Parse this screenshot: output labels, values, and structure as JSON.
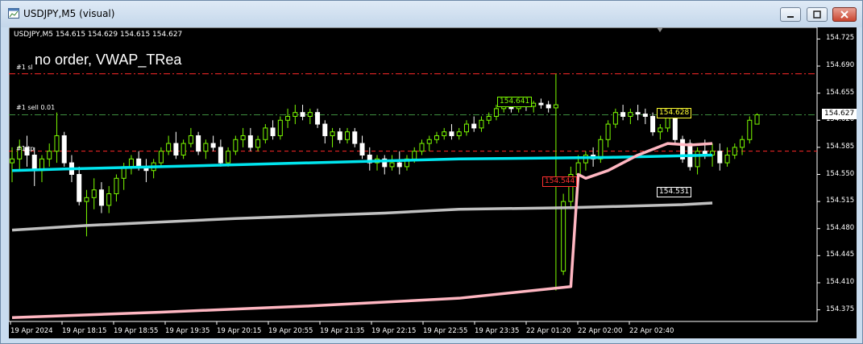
{
  "window": {
    "title": "USDJPY,M5 (visual)",
    "icon": "chart-window-icon",
    "buttons": [
      "minimize-icon",
      "maximize-icon",
      "close-icon"
    ]
  },
  "chart": {
    "info_line": "USDJPY,M5  154.615 154.629 154.615 154.627",
    "comment": "no order, VWAP_TRea",
    "level_labels": {
      "sl": "#1 sl",
      "sell": "#1 sell 0.01",
      "tp": "#1 tp"
    },
    "price_labels": {
      "green": "154.641",
      "red": "154.544",
      "bid": "154.627",
      "yellow": "154.628",
      "white": "154.531"
    },
    "colors": {
      "background": "#000000",
      "bull": "#7cfc00",
      "bear": "#ffffff",
      "vwap_fast": "#00e5ee",
      "vwap_slow": "#c0c0c0",
      "vwap_pink": "#ffb6c1",
      "sl_line": "#ff2a2a",
      "sell_line": "#3f8f3f"
    }
  },
  "chart_data": {
    "type": "line",
    "symbol": "USDJPY",
    "timeframe": "M5",
    "ylim": [
      154.36,
      154.74
    ],
    "y_ticks": [
      "154.725",
      "154.690",
      "154.655",
      "154.620",
      "154.585",
      "154.550",
      "154.515",
      "154.480",
      "154.445",
      "154.410",
      "154.375"
    ],
    "x_ticks": [
      "19 Apr 2024",
      "19 Apr 18:15",
      "19 Apr 18:55",
      "19 Apr 19:35",
      "19 Apr 20:15",
      "19 Apr 20:55",
      "19 Apr 21:35",
      "19 Apr 22:15",
      "19 Apr 22:55",
      "19 Apr 23:35",
      "22 Apr 01:20",
      "22 Apr 02:00",
      "22 Apr 02:40"
    ],
    "levels": [
      {
        "name": "#1 sl",
        "value": 154.68,
        "style": "dash-dot",
        "color": "#ff2a2a"
      },
      {
        "name": "#1 sell 0.01",
        "value": 154.627,
        "style": "dash-dot",
        "color": "#3f8f3f"
      },
      {
        "name": "#1 tp",
        "value": 154.58,
        "style": "dash",
        "color": "#ff2a2a"
      }
    ],
    "candles": [
      {
        "o": 154.565,
        "h": 154.585,
        "l": 154.54,
        "c": 154.57
      },
      {
        "o": 154.57,
        "h": 154.595,
        "l": 154.555,
        "c": 154.585
      },
      {
        "o": 154.585,
        "h": 154.6,
        "l": 154.56,
        "c": 154.575
      },
      {
        "o": 154.575,
        "h": 154.585,
        "l": 154.535,
        "c": 154.555
      },
      {
        "o": 154.555,
        "h": 154.575,
        "l": 154.54,
        "c": 154.57
      },
      {
        "o": 154.57,
        "h": 154.59,
        "l": 154.56,
        "c": 154.58
      },
      {
        "o": 154.58,
        "h": 154.63,
        "l": 154.565,
        "c": 154.6
      },
      {
        "o": 154.6,
        "h": 154.605,
        "l": 154.56,
        "c": 154.565
      },
      {
        "o": 154.565,
        "h": 154.575,
        "l": 154.54,
        "c": 154.55
      },
      {
        "o": 154.55,
        "h": 154.56,
        "l": 154.51,
        "c": 154.515
      },
      {
        "o": 154.515,
        "h": 154.53,
        "l": 154.47,
        "c": 154.52
      },
      {
        "o": 154.52,
        "h": 154.545,
        "l": 154.505,
        "c": 154.53
      },
      {
        "o": 154.53,
        "h": 154.54,
        "l": 154.5,
        "c": 154.51
      },
      {
        "o": 154.51,
        "h": 154.535,
        "l": 154.5,
        "c": 154.525
      },
      {
        "o": 154.525,
        "h": 154.55,
        "l": 154.515,
        "c": 154.545
      },
      {
        "o": 154.545,
        "h": 154.565,
        "l": 154.53,
        "c": 154.56
      },
      {
        "o": 154.56,
        "h": 154.575,
        "l": 154.55,
        "c": 154.57
      },
      {
        "o": 154.57,
        "h": 154.58,
        "l": 154.555,
        "c": 154.56
      },
      {
        "o": 154.56,
        "h": 154.57,
        "l": 154.54,
        "c": 154.555
      },
      {
        "o": 154.555,
        "h": 154.57,
        "l": 154.545,
        "c": 154.565
      },
      {
        "o": 154.565,
        "h": 154.585,
        "l": 154.56,
        "c": 154.58
      },
      {
        "o": 154.58,
        "h": 154.6,
        "l": 154.575,
        "c": 154.59
      },
      {
        "o": 154.59,
        "h": 154.605,
        "l": 154.57,
        "c": 154.575
      },
      {
        "o": 154.575,
        "h": 154.595,
        "l": 154.57,
        "c": 154.59
      },
      {
        "o": 154.59,
        "h": 154.61,
        "l": 154.585,
        "c": 154.6
      },
      {
        "o": 154.6,
        "h": 154.605,
        "l": 154.575,
        "c": 154.58
      },
      {
        "o": 154.58,
        "h": 154.595,
        "l": 154.57,
        "c": 154.59
      },
      {
        "o": 154.59,
        "h": 154.6,
        "l": 154.58,
        "c": 154.585
      },
      {
        "o": 154.585,
        "h": 154.595,
        "l": 154.56,
        "c": 154.565
      },
      {
        "o": 154.565,
        "h": 154.585,
        "l": 154.56,
        "c": 154.58
      },
      {
        "o": 154.58,
        "h": 154.6,
        "l": 154.575,
        "c": 154.595
      },
      {
        "o": 154.595,
        "h": 154.61,
        "l": 154.585,
        "c": 154.6
      },
      {
        "o": 154.6,
        "h": 154.61,
        "l": 154.58,
        "c": 154.585
      },
      {
        "o": 154.585,
        "h": 154.6,
        "l": 154.58,
        "c": 154.595
      },
      {
        "o": 154.595,
        "h": 154.615,
        "l": 154.59,
        "c": 154.61
      },
      {
        "o": 154.61,
        "h": 154.62,
        "l": 154.595,
        "c": 154.6
      },
      {
        "o": 154.6,
        "h": 154.625,
        "l": 154.595,
        "c": 154.62
      },
      {
        "o": 154.62,
        "h": 154.635,
        "l": 154.61,
        "c": 154.625
      },
      {
        "o": 154.625,
        "h": 154.64,
        "l": 154.615,
        "c": 154.63
      },
      {
        "o": 154.63,
        "h": 154.64,
        "l": 154.62,
        "c": 154.625
      },
      {
        "o": 154.625,
        "h": 154.635,
        "l": 154.615,
        "c": 154.63
      },
      {
        "o": 154.63,
        "h": 154.635,
        "l": 154.61,
        "c": 154.615
      },
      {
        "o": 154.615,
        "h": 154.62,
        "l": 154.59,
        "c": 154.6
      },
      {
        "o": 154.6,
        "h": 154.61,
        "l": 154.585,
        "c": 154.605
      },
      {
        "o": 154.605,
        "h": 154.61,
        "l": 154.59,
        "c": 154.595
      },
      {
        "o": 154.595,
        "h": 154.61,
        "l": 154.59,
        "c": 154.605
      },
      {
        "o": 154.605,
        "h": 154.61,
        "l": 154.585,
        "c": 154.59
      },
      {
        "o": 154.59,
        "h": 154.6,
        "l": 154.57,
        "c": 154.575
      },
      {
        "o": 154.575,
        "h": 154.585,
        "l": 154.555,
        "c": 154.565
      },
      {
        "o": 154.565,
        "h": 154.575,
        "l": 154.555,
        "c": 154.57
      },
      {
        "o": 154.57,
        "h": 154.575,
        "l": 154.55,
        "c": 154.56
      },
      {
        "o": 154.56,
        "h": 154.575,
        "l": 154.555,
        "c": 154.565
      },
      {
        "o": 154.565,
        "h": 154.58,
        "l": 154.55,
        "c": 154.56
      },
      {
        "o": 154.56,
        "h": 154.575,
        "l": 154.555,
        "c": 154.57
      },
      {
        "o": 154.57,
        "h": 154.585,
        "l": 154.565,
        "c": 154.58
      },
      {
        "o": 154.58,
        "h": 154.595,
        "l": 154.575,
        "c": 154.59
      },
      {
        "o": 154.59,
        "h": 154.6,
        "l": 154.58,
        "c": 154.595
      },
      {
        "o": 154.595,
        "h": 154.605,
        "l": 154.59,
        "c": 154.6
      },
      {
        "o": 154.6,
        "h": 154.61,
        "l": 154.595,
        "c": 154.605
      },
      {
        "o": 154.605,
        "h": 154.615,
        "l": 154.595,
        "c": 154.6
      },
      {
        "o": 154.6,
        "h": 154.61,
        "l": 154.595,
        "c": 154.605
      },
      {
        "o": 154.605,
        "h": 154.62,
        "l": 154.6,
        "c": 154.615
      },
      {
        "o": 154.615,
        "h": 154.625,
        "l": 154.605,
        "c": 154.61
      },
      {
        "o": 154.61,
        "h": 154.625,
        "l": 154.605,
        "c": 154.62
      },
      {
        "o": 154.62,
        "h": 154.63,
        "l": 154.615,
        "c": 154.625
      },
      {
        "o": 154.625,
        "h": 154.64,
        "l": 154.62,
        "c": 154.635
      },
      {
        "o": 154.635,
        "h": 154.65,
        "l": 154.63,
        "c": 154.645
      },
      {
        "o": 154.645,
        "h": 154.65,
        "l": 154.63,
        "c": 154.635
      },
      {
        "o": 154.635,
        "h": 154.645,
        "l": 154.63,
        "c": 154.64
      },
      {
        "o": 154.64,
        "h": 154.648,
        "l": 154.632,
        "c": 154.638
      },
      {
        "o": 154.638,
        "h": 154.645,
        "l": 154.63,
        "c": 154.642
      },
      {
        "o": 154.642,
        "h": 154.648,
        "l": 154.635,
        "c": 154.64
      },
      {
        "o": 154.64,
        "h": 154.645,
        "l": 154.63,
        "c": 154.636
      },
      {
        "o": 154.636,
        "h": 154.68,
        "l": 154.4,
        "c": 154.64
      },
      {
        "o": 154.425,
        "h": 154.525,
        "l": 154.42,
        "c": 154.515
      },
      {
        "o": 154.515,
        "h": 154.56,
        "l": 154.505,
        "c": 154.55
      },
      {
        "o": 154.55,
        "h": 154.575,
        "l": 154.54,
        "c": 154.565
      },
      {
        "o": 154.565,
        "h": 154.58,
        "l": 154.555,
        "c": 154.575
      },
      {
        "o": 154.575,
        "h": 154.585,
        "l": 154.56,
        "c": 154.57
      },
      {
        "o": 154.57,
        "h": 154.6,
        "l": 154.565,
        "c": 154.595
      },
      {
        "o": 154.595,
        "h": 154.62,
        "l": 154.585,
        "c": 154.615
      },
      {
        "o": 154.615,
        "h": 154.635,
        "l": 154.61,
        "c": 154.63
      },
      {
        "o": 154.63,
        "h": 154.64,
        "l": 154.62,
        "c": 154.625
      },
      {
        "o": 154.625,
        "h": 154.635,
        "l": 154.615,
        "c": 154.63
      },
      {
        "o": 154.63,
        "h": 154.64,
        "l": 154.62,
        "c": 154.628
      },
      {
        "o": 154.628,
        "h": 154.635,
        "l": 154.615,
        "c": 154.625
      },
      {
        "o": 154.625,
        "h": 154.63,
        "l": 154.6,
        "c": 154.605
      },
      {
        "o": 154.605,
        "h": 154.615,
        "l": 154.595,
        "c": 154.61
      },
      {
        "o": 154.61,
        "h": 154.632,
        "l": 154.605,
        "c": 154.63
      },
      {
        "o": 154.63,
        "h": 154.632,
        "l": 154.59,
        "c": 154.595
      },
      {
        "o": 154.595,
        "h": 154.6,
        "l": 154.565,
        "c": 154.57
      },
      {
        "o": 154.59,
        "h": 154.595,
        "l": 154.555,
        "c": 154.56
      },
      {
        "o": 154.56,
        "h": 154.585,
        "l": 154.55,
        "c": 154.58
      },
      {
        "o": 154.58,
        "h": 154.595,
        "l": 154.57,
        "c": 154.575
      },
      {
        "o": 154.575,
        "h": 154.59,
        "l": 154.56,
        "c": 154.58
      },
      {
        "o": 154.58,
        "h": 154.59,
        "l": 154.555,
        "c": 154.565
      },
      {
        "o": 154.565,
        "h": 154.585,
        "l": 154.56,
        "c": 154.575
      },
      {
        "o": 154.575,
        "h": 154.59,
        "l": 154.57,
        "c": 154.585
      },
      {
        "o": 154.585,
        "h": 154.6,
        "l": 154.575,
        "c": 154.595
      },
      {
        "o": 154.595,
        "h": 154.625,
        "l": 154.59,
        "c": 154.62
      },
      {
        "o": 154.615,
        "h": 154.629,
        "l": 154.615,
        "c": 154.627
      }
    ],
    "series": [
      {
        "values": [
          [
            0,
            154.555
          ],
          [
            7,
            154.557
          ],
          [
            20,
            154.56
          ],
          [
            40,
            154.565
          ],
          [
            60,
            154.57
          ],
          [
            80,
            154.572
          ],
          [
            94,
            154.575
          ]
        ]
      },
      {
        "values": [
          [
            0,
            154.478
          ],
          [
            5,
            154.481
          ],
          [
            10,
            154.484
          ],
          [
            30,
            154.493
          ],
          [
            50,
            154.5
          ],
          [
            60,
            154.505
          ],
          [
            75,
            154.507
          ],
          [
            90,
            154.511
          ],
          [
            94,
            154.513
          ]
        ]
      },
      {
        "values": [
          [
            0,
            154.365
          ],
          [
            20,
            154.372
          ],
          [
            40,
            154.38
          ],
          [
            60,
            154.39
          ],
          [
            75,
            154.405
          ],
          [
            76,
            154.55
          ],
          [
            77,
            154.545
          ],
          [
            80,
            154.555
          ],
          [
            84,
            154.575
          ],
          [
            88,
            154.59
          ],
          [
            91,
            154.588
          ],
          [
            94,
            154.59
          ]
        ]
      }
    ]
  }
}
